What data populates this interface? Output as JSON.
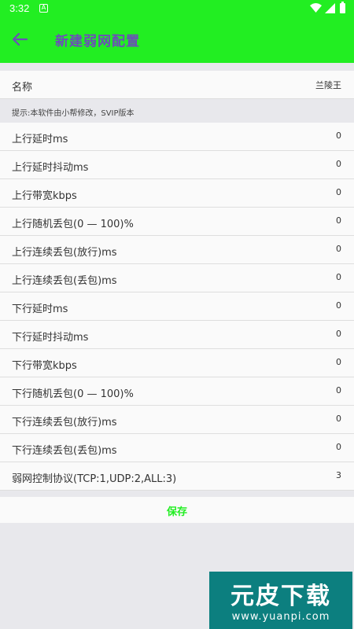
{
  "status_bar": {
    "time": "3:32",
    "notification_icon": "A"
  },
  "app_bar": {
    "title": "新建弱网配置",
    "back_icon": "arrow-left-icon"
  },
  "name_row": {
    "label": "名称",
    "value": "兰陵王"
  },
  "hint": "提示:本软件由小帮修改，SVIP版本",
  "rows": [
    {
      "label": "上行延时ms",
      "value": "0"
    },
    {
      "label": "上行延时抖动ms",
      "value": "0"
    },
    {
      "label": "上行带宽kbps",
      "value": "0"
    },
    {
      "label": "上行随机丢包(0 — 100)%",
      "value": "0"
    },
    {
      "label": "上行连续丢包(放行)ms",
      "value": "0"
    },
    {
      "label": "上行连续丢包(丢包)ms",
      "value": "0"
    },
    {
      "label": "下行延时ms",
      "value": "0"
    },
    {
      "label": "下行延时抖动ms",
      "value": "0"
    },
    {
      "label": "下行带宽kbps",
      "value": "0"
    },
    {
      "label": "下行随机丢包(0 — 100)%",
      "value": "0"
    },
    {
      "label": "下行连续丢包(放行)ms",
      "value": "0"
    },
    {
      "label": "下行连续丢包(丢包)ms",
      "value": "0"
    },
    {
      "label": "弱网控制协议(TCP:1,UDP:2,ALL:3)",
      "value": "3"
    }
  ],
  "save_label": "保存",
  "watermark": {
    "main": "元皮下载",
    "url": "www.yuanpi.com"
  },
  "colors": {
    "accent": "#22ee22",
    "title": "#6b4fb8",
    "background": "#e8e8ec",
    "watermark_bg": "#0c7f7f"
  }
}
